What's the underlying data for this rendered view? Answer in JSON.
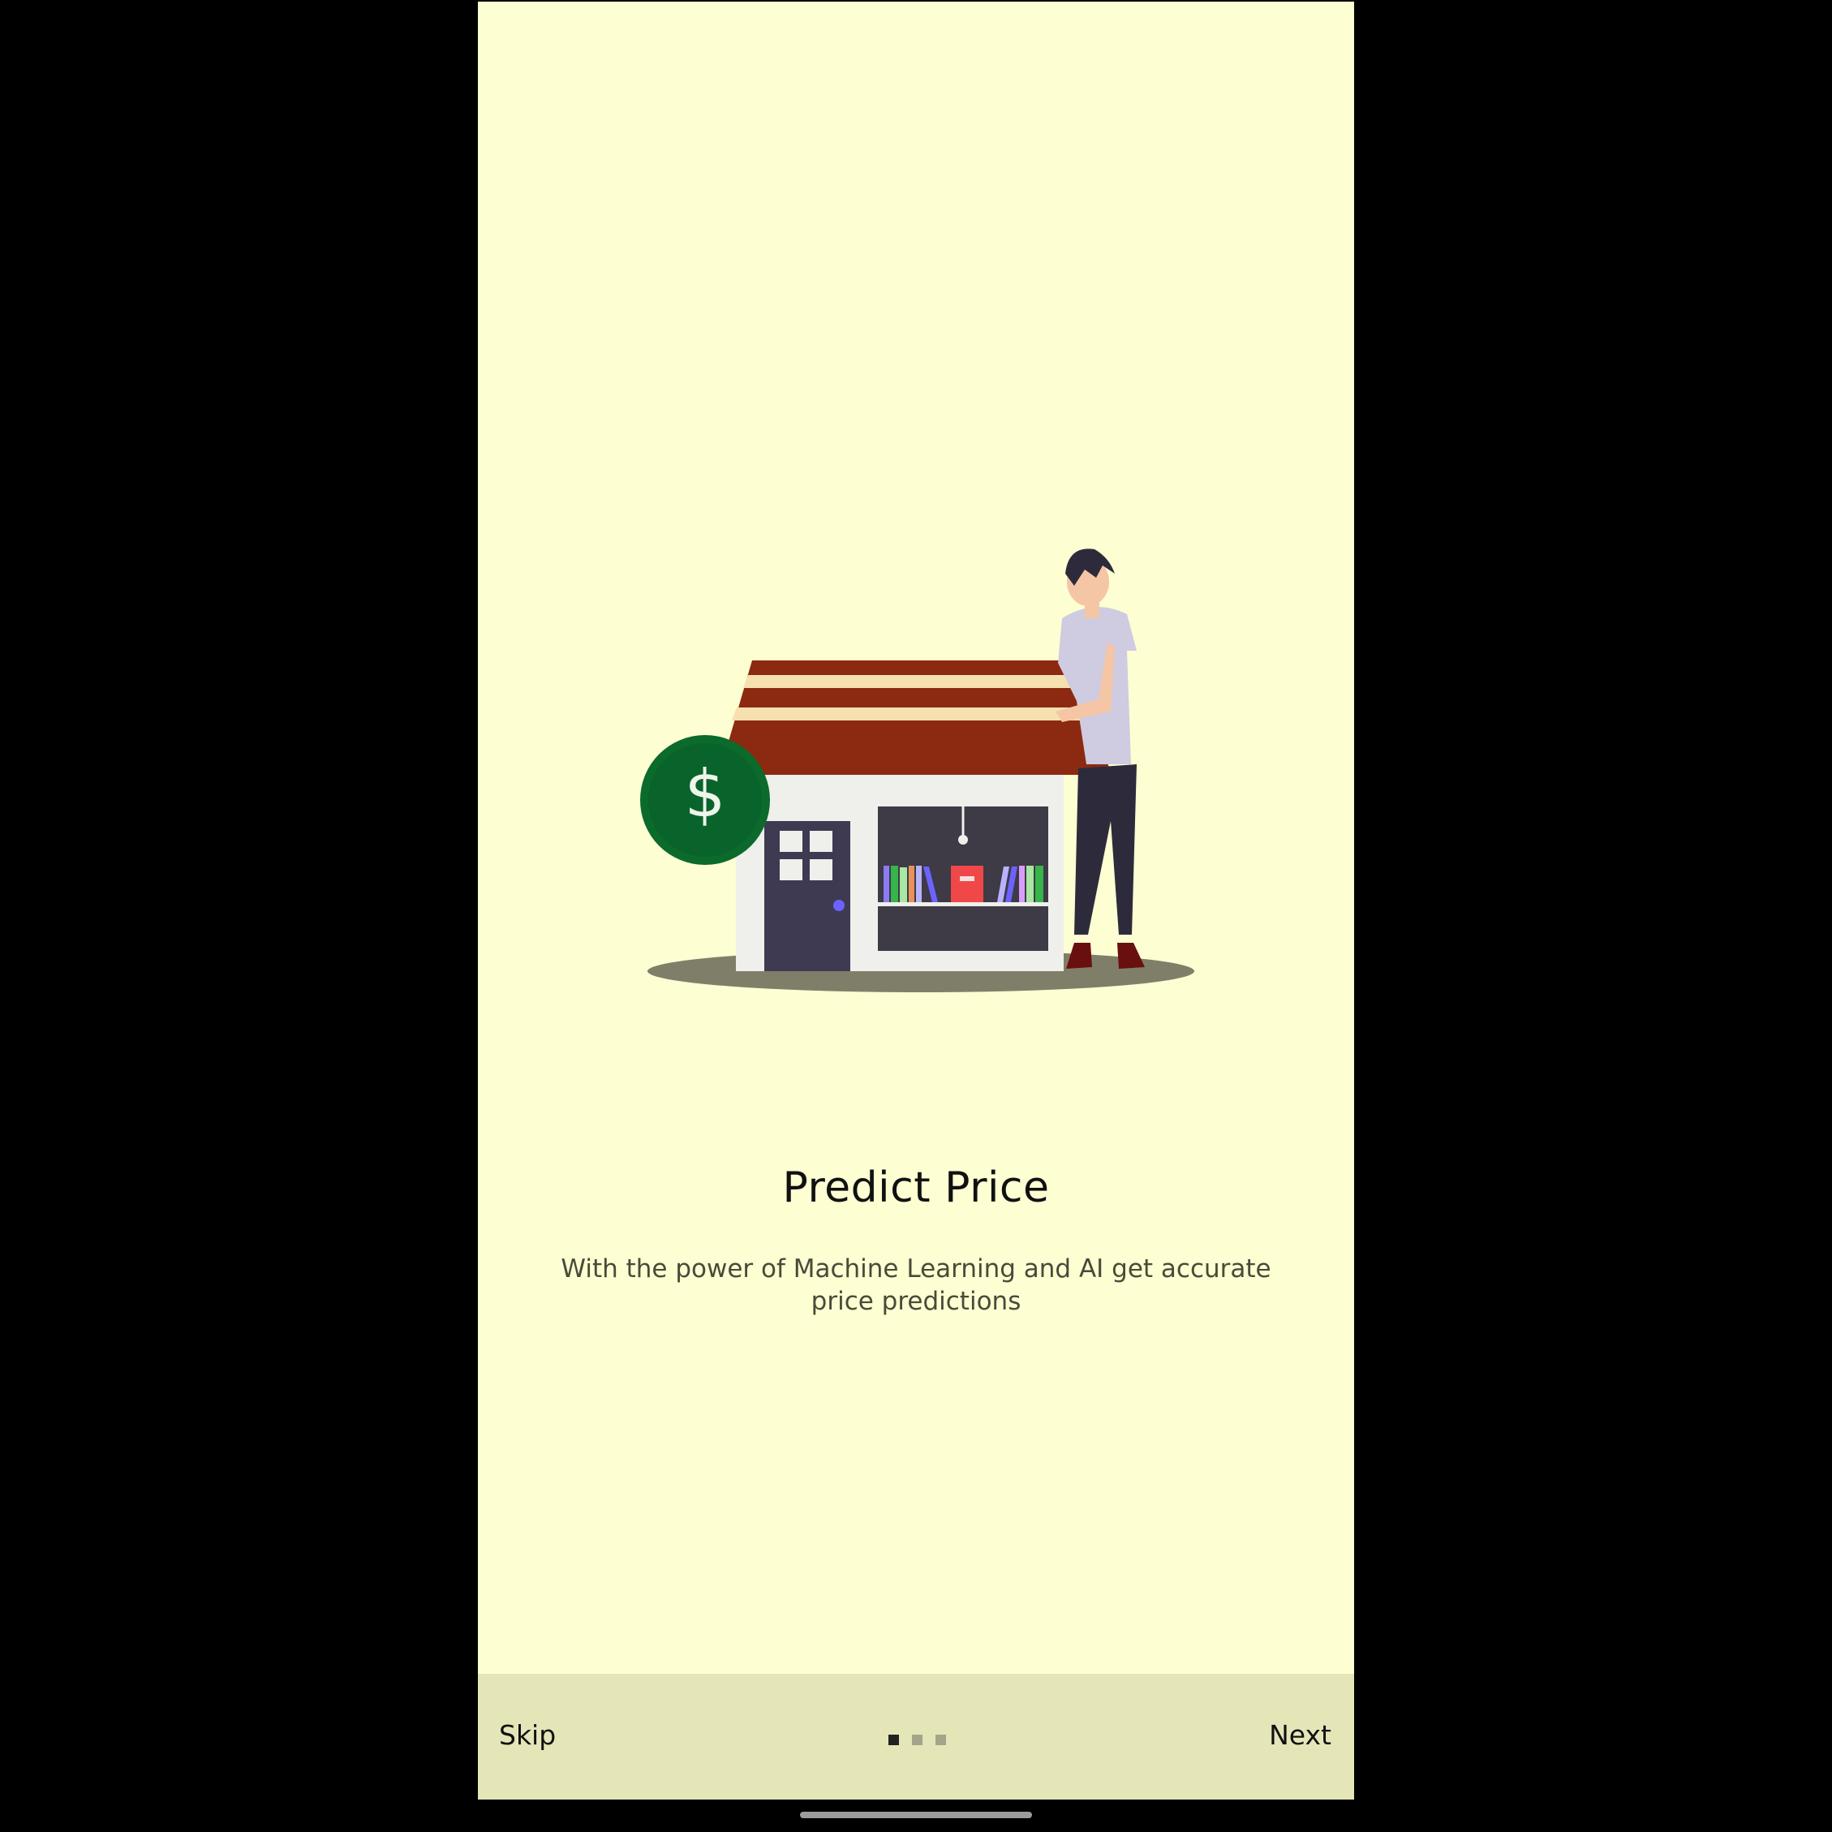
{
  "onboarding": {
    "title": "Predict Price",
    "description": "With the power of Machine Learning and AI get accurate price predictions",
    "pager": {
      "current": 1,
      "total": 3
    }
  },
  "illustration": {
    "icon": "dollar-coin-icon",
    "coin_symbol": "$"
  },
  "bottom_bar": {
    "skip_label": "Skip",
    "next_label": "Next"
  },
  "colors": {
    "background": "#fdfed2",
    "bottom_bar": "#e4e6b8",
    "coin": "#0b6a2c",
    "roof": "#8b2a10",
    "roof_stripe": "#f7e0b0"
  }
}
